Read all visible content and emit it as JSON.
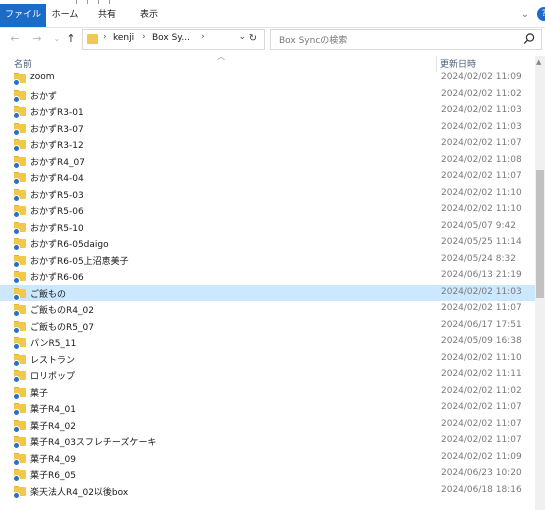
{
  "ribbon": {
    "tabs": [
      "ファイル",
      "ホーム",
      "共有",
      "表示"
    ]
  },
  "address": {
    "crumbs": [
      "kenji",
      "Box Sy..."
    ],
    "search_placeholder": "Box Syncの検索"
  },
  "columns": {
    "name": "名前",
    "date": "更新日時"
  },
  "files": [
    {
      "name": "zoom",
      "date": "2024/02/02 11:09"
    },
    {
      "name": "おかず",
      "date": "2024/02/02 11:02"
    },
    {
      "name": "おかずR3-01",
      "date": "2024/02/02 11:03"
    },
    {
      "name": "おかずR3-07",
      "date": "2024/02/02 11:03"
    },
    {
      "name": "おかずR3-12",
      "date": "2024/02/02 11:07"
    },
    {
      "name": "おかずR4_07",
      "date": "2024/02/02 11:08"
    },
    {
      "name": "おかずR4-04",
      "date": "2024/02/02 11:07"
    },
    {
      "name": "おかずR5-03",
      "date": "2024/02/02 11:10"
    },
    {
      "name": "おかずR5-06",
      "date": "2024/02/02 11:10"
    },
    {
      "name": "おかずR5-10",
      "date": "2024/05/07 9:42"
    },
    {
      "name": "おかずR6-05daigo",
      "date": "2024/05/25 11:14"
    },
    {
      "name": "おかずR6-05上沼恵美子",
      "date": "2024/05/24 8:32"
    },
    {
      "name": "おかずR6-06",
      "date": "2024/06/13 21:19"
    },
    {
      "name": "ご飯もの",
      "date": "2024/02/02 11:03",
      "selected": true
    },
    {
      "name": "ご飯ものR4_02",
      "date": "2024/02/02 11:07"
    },
    {
      "name": "ご飯ものR5_07",
      "date": "2024/06/17 17:51"
    },
    {
      "name": "パンR5_11",
      "date": "2024/05/09 16:38"
    },
    {
      "name": "レストラン",
      "date": "2024/02/02 11:10"
    },
    {
      "name": "ロリポップ",
      "date": "2024/02/02 11:11"
    },
    {
      "name": "菓子",
      "date": "2024/02/02 11:02"
    },
    {
      "name": "菓子R4_01",
      "date": "2024/02/02 11:07"
    },
    {
      "name": "菓子R4_02",
      "date": "2024/02/02 11:07"
    },
    {
      "name": "菓子R4_03スフレチーズケーキ",
      "date": "2024/02/02 11:07"
    },
    {
      "name": "菓子R4_09",
      "date": "2024/02/02 11:09"
    },
    {
      "name": "菓子R6_05",
      "date": "2024/06/23 10:20"
    },
    {
      "name": "楽天法人R4_02以後box",
      "date": "2024/06/18 18:16"
    }
  ],
  "colors": {
    "file_tab": "#1c6bc7",
    "selection": "#cce8ff",
    "folder": "#f2c84b",
    "sync_badge": "#2a6fc9"
  }
}
